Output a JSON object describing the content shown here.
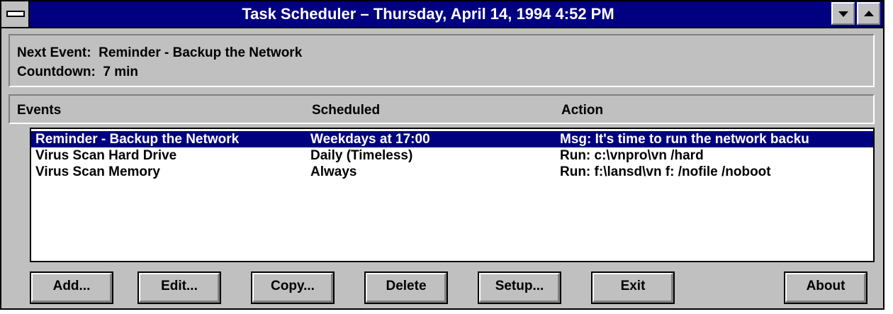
{
  "window": {
    "title": "Task Scheduler – Thursday, April 14, 1994 4:52 PM"
  },
  "next_event": {
    "label": "Next Event:",
    "value": "Reminder - Backup the Network",
    "countdown_label": "Countdown:",
    "countdown_value": "7 min"
  },
  "columns": {
    "events": "Events",
    "scheduled": "Scheduled",
    "action": "Action"
  },
  "rows": [
    {
      "event": "Reminder - Backup the Network",
      "scheduled": "Weekdays at 17:00",
      "action": "Msg: It's time to run the network backu",
      "selected": true
    },
    {
      "event": "Virus Scan Hard Drive",
      "scheduled": "Daily (Timeless)",
      "action": "Run: c:\\vnpro\\vn /hard",
      "selected": false
    },
    {
      "event": "Virus Scan Memory",
      "scheduled": "Always",
      "action": "Run: f:\\lansd\\vn f: /nofile /noboot",
      "selected": false
    }
  ],
  "buttons": {
    "add": "Add...",
    "edit": "Edit...",
    "copy": "Copy...",
    "delete": "Delete",
    "setup": "Setup...",
    "exit": "Exit",
    "about": "About"
  },
  "colors": {
    "titlebar": "#000080",
    "selection": "#000080",
    "face": "#c0c0c0"
  }
}
